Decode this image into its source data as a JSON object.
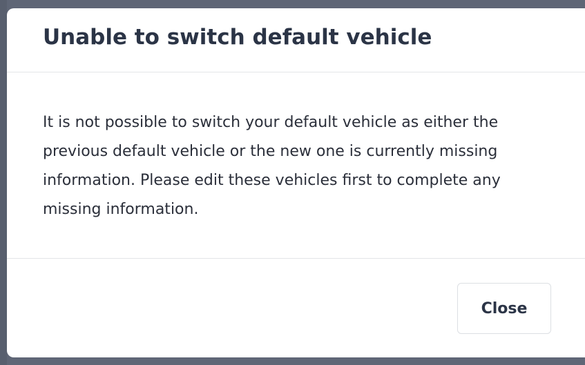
{
  "dialog": {
    "title": "Unable to switch default vehicle",
    "message": "It is not possible to switch your default vehicle as either the previous default vehicle or the new one is currently missing information. Please edit these vehicles first to complete any missing information.",
    "close_label": "Close"
  },
  "colors": {
    "overlay": "#5b6272",
    "dialog_background": "#ffffff",
    "title_text": "#2b3446",
    "body_text": "#2b2f3a",
    "divider": "#e3e5e8",
    "button_border": "#dcdfe3"
  }
}
